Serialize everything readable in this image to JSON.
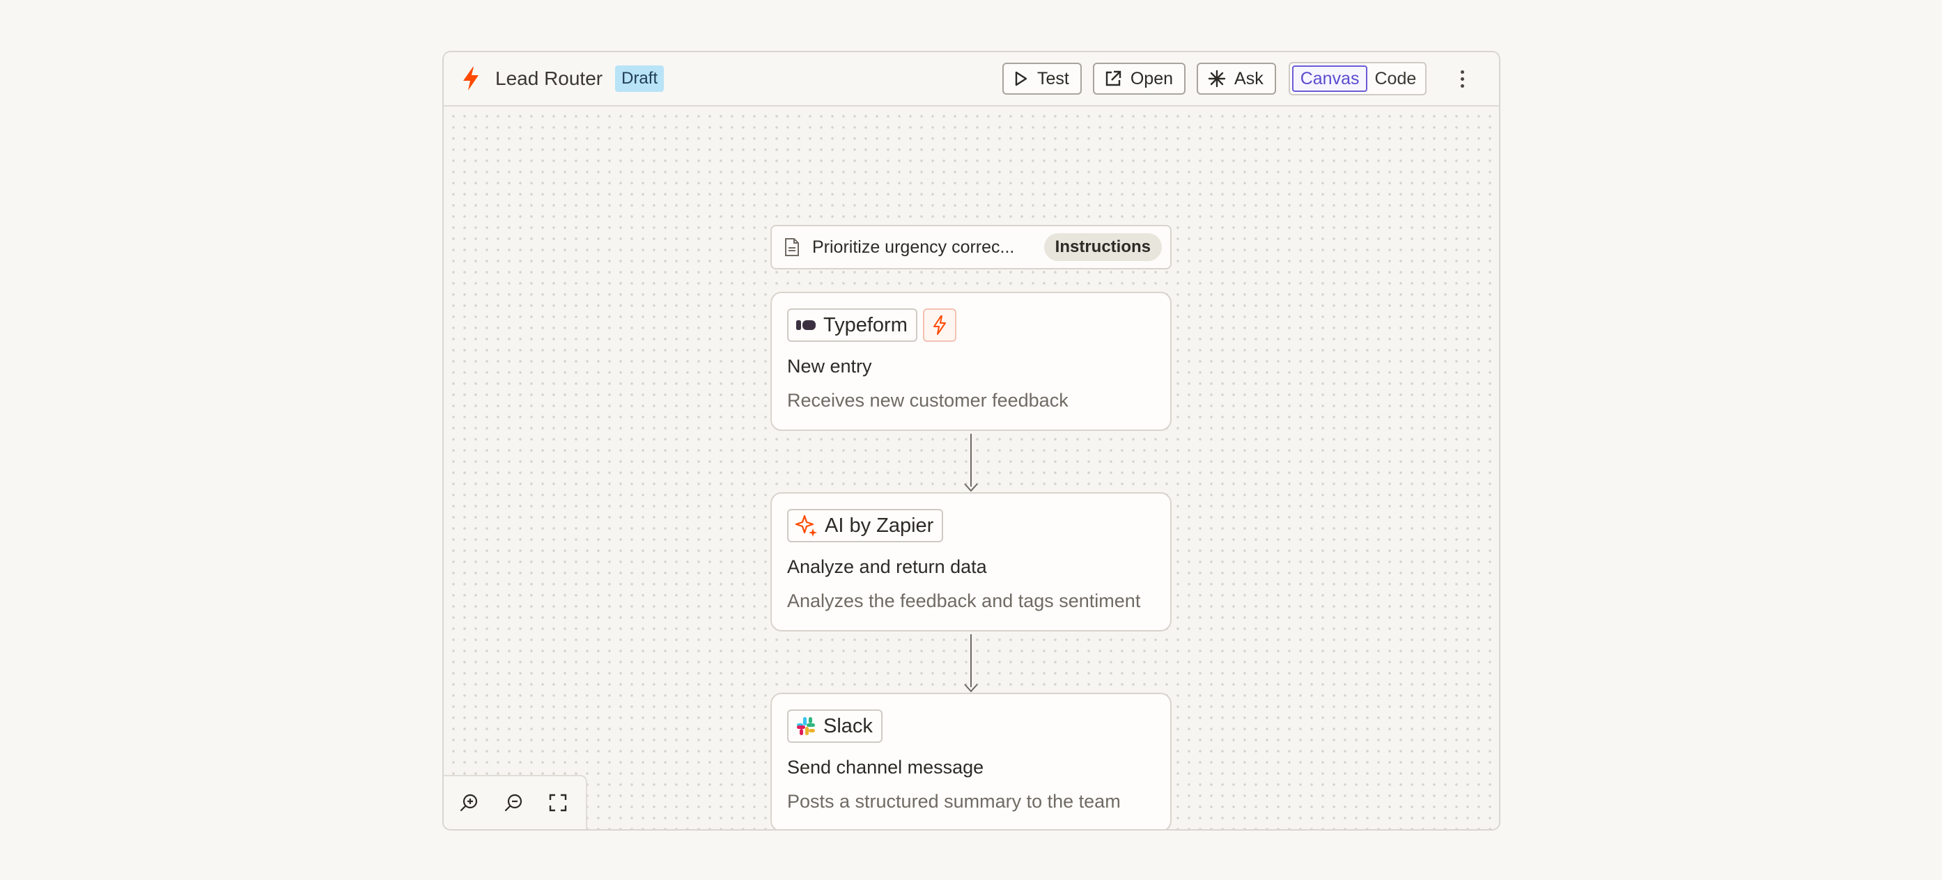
{
  "header": {
    "title": "Lead Router",
    "status_badge": "Draft",
    "buttons": {
      "test": "Test",
      "open": "Open",
      "ask": "Ask"
    },
    "view_toggle": {
      "options": [
        "Canvas",
        "Code"
      ],
      "selected": "Canvas"
    }
  },
  "instructions": {
    "text": "Prioritize urgency correc...",
    "chip": "Instructions"
  },
  "nodes": [
    {
      "app": "Typeform",
      "icon": "typeform-icon",
      "is_trigger": true,
      "title": "New entry",
      "description": "Receives new customer feedback"
    },
    {
      "app": "AI by Zapier",
      "icon": "sparkle-icon",
      "is_trigger": false,
      "title": "Analyze and return data",
      "description": "Analyzes the feedback and tags sentiment"
    },
    {
      "app": "Slack",
      "icon": "slack-icon",
      "is_trigger": false,
      "title": "Send channel message",
      "description": "Posts a structured summary to the team"
    }
  ],
  "colors": {
    "brand_orange": "#ff4a00",
    "draft_badge": "#b9e3f7",
    "active_toggle": "#6b5bd6",
    "connector": "#6e6a63"
  }
}
